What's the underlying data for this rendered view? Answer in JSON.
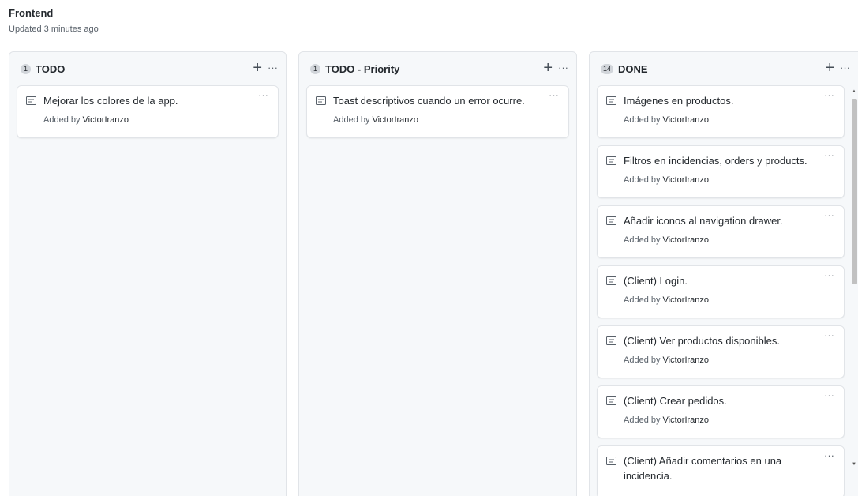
{
  "project": {
    "title": "Frontend",
    "updated": "Updated 3 minutes ago"
  },
  "columns": [
    {
      "count": "1",
      "name": "TODO",
      "cards": [
        {
          "title": "Mejorar los colores de la app.",
          "added_by": "Added by",
          "author": "VictorIranzo"
        }
      ]
    },
    {
      "count": "1",
      "name": "TODO - Priority",
      "cards": [
        {
          "title": "Toast descriptivos cuando un error ocurre.",
          "added_by": "Added by",
          "author": "VictorIranzo"
        }
      ]
    },
    {
      "count": "14",
      "name": "DONE",
      "cards": [
        {
          "title": "Imágenes en productos.",
          "added_by": "Added by",
          "author": "VictorIranzo"
        },
        {
          "title": "Filtros en incidencias, orders y products.",
          "added_by": "Added by",
          "author": "VictorIranzo"
        },
        {
          "title": "Añadir iconos al navigation drawer.",
          "added_by": "Added by",
          "author": "VictorIranzo"
        },
        {
          "title": "(Client) Login.",
          "added_by": "Added by",
          "author": "VictorIranzo"
        },
        {
          "title": "(Client) Ver productos disponibles.",
          "added_by": "Added by",
          "author": "VictorIranzo"
        },
        {
          "title": "(Client) Crear pedidos.",
          "added_by": "Added by",
          "author": "VictorIranzo"
        },
        {
          "title": "(Client) Añadir comentarios en una incidencia.",
          "added_by": "",
          "author": ""
        }
      ]
    }
  ],
  "icons": {
    "add": "plus-icon",
    "menu": "kebab-horizontal-icon",
    "note": "note-icon"
  },
  "colors": {
    "column_bg": "#f6f8fa",
    "card_border": "#e1e4e8",
    "badge_bg": "#d1d5da",
    "muted_text": "#586069"
  }
}
